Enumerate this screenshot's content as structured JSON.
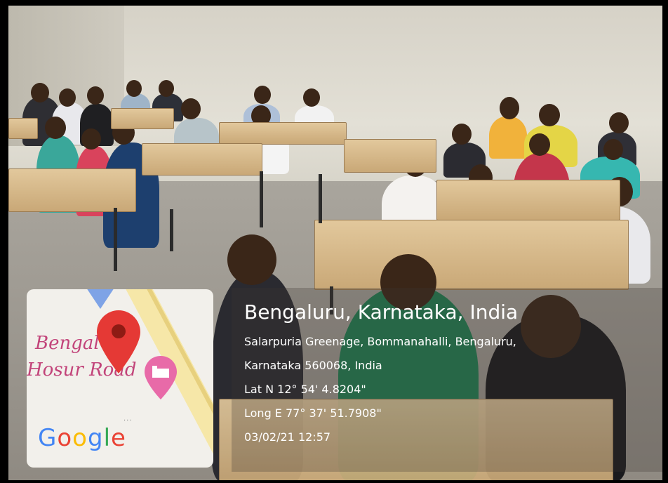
{
  "geotag": {
    "city": "Bengaluru, Karnataka, India",
    "address_line_1": "Salarpuria Greenage, Bommanahalli, Bengaluru,",
    "address_line_2": "Karnataka 560068, India",
    "latitude": "Lat N 12° 54' 4.8204\"",
    "longitude": "Long E 77° 37' 51.7908\"",
    "datetime": "03/02/21 12:57"
  },
  "map": {
    "label_1": "Bengal",
    "label_2": "Hosur Road",
    "logo_letters": [
      {
        "ch": "G",
        "color": "#4285F4"
      },
      {
        "ch": "o",
        "color": "#EA4335"
      },
      {
        "ch": "o",
        "color": "#FBBC05"
      },
      {
        "ch": "g",
        "color": "#4285F4"
      },
      {
        "ch": "l",
        "color": "#34A853"
      },
      {
        "ch": "e",
        "color": "#EA4335"
      }
    ],
    "pin_icon": "red-location-pin",
    "hotel_icon": "hotel-bed-pin"
  },
  "scene": {
    "subject": "classroom with students seated at wooden desks"
  }
}
